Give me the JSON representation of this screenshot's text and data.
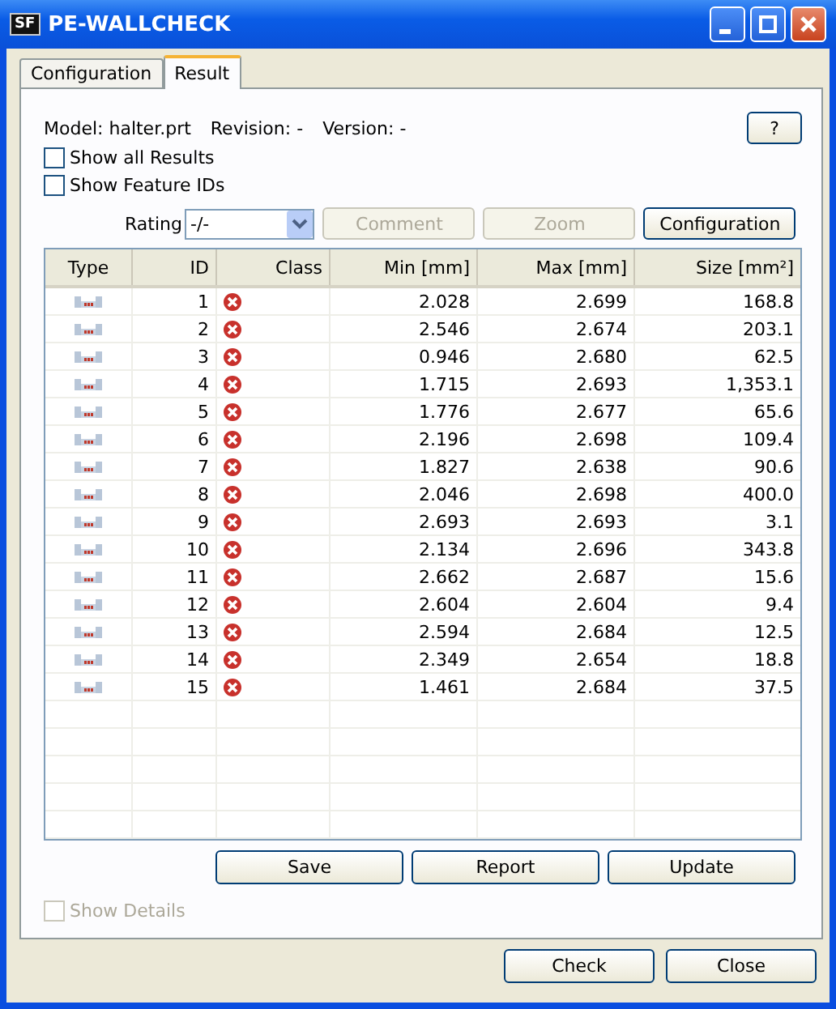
{
  "window": {
    "app_icon": "SF",
    "title": "PE-WALLCHECK"
  },
  "tabs": [
    {
      "label": "Configuration",
      "selected": false
    },
    {
      "label": "Result",
      "selected": true
    }
  ],
  "model_line": {
    "model": "Model:  halter.prt",
    "revision": "Revision:  -",
    "version": "Version:  -"
  },
  "help_button": {
    "label": "?"
  },
  "checkboxes": [
    {
      "label": "Show all Results",
      "checked": false
    },
    {
      "label": "Show Feature IDs",
      "checked": false
    }
  ],
  "rating": {
    "label": "Rating",
    "value": "-/-"
  },
  "toolbar_buttons": [
    {
      "label": "Comment",
      "disabled": true
    },
    {
      "label": "Zoom",
      "disabled": true
    },
    {
      "label": "Configuration",
      "disabled": false
    }
  ],
  "table": {
    "columns": [
      "Type",
      "ID",
      "Class",
      "Min [mm]",
      "Max [mm]",
      "Size [mm²]"
    ],
    "rows": [
      {
        "id": "1",
        "kind": "error",
        "min": "2.028",
        "max": "2.699",
        "size": "168.8"
      },
      {
        "id": "2",
        "kind": "error",
        "min": "2.546",
        "max": "2.674",
        "size": "203.1"
      },
      {
        "id": "3",
        "kind": "error",
        "min": "0.946",
        "max": "2.680",
        "size": "62.5"
      },
      {
        "id": "4",
        "kind": "error",
        "min": "1.715",
        "max": "2.693",
        "size": "1,353.1"
      },
      {
        "id": "5",
        "kind": "error",
        "min": "1.776",
        "max": "2.677",
        "size": "65.6"
      },
      {
        "id": "6",
        "kind": "error",
        "min": "2.196",
        "max": "2.698",
        "size": "109.4"
      },
      {
        "id": "7",
        "kind": "error",
        "min": "1.827",
        "max": "2.638",
        "size": "90.6"
      },
      {
        "id": "8",
        "kind": "error",
        "min": "2.046",
        "max": "2.698",
        "size": "400.0"
      },
      {
        "id": "9",
        "kind": "error",
        "min": "2.693",
        "max": "2.693",
        "size": "3.1"
      },
      {
        "id": "10",
        "kind": "error",
        "min": "2.134",
        "max": "2.696",
        "size": "343.8"
      },
      {
        "id": "11",
        "kind": "error",
        "min": "2.662",
        "max": "2.687",
        "size": "15.6"
      },
      {
        "id": "12",
        "kind": "error",
        "min": "2.604",
        "max": "2.604",
        "size": "9.4"
      },
      {
        "id": "13",
        "kind": "error",
        "min": "2.594",
        "max": "2.684",
        "size": "12.5"
      },
      {
        "id": "14",
        "kind": "error",
        "min": "2.349",
        "max": "2.654",
        "size": "18.8"
      },
      {
        "id": "15",
        "kind": "error",
        "min": "1.461",
        "max": "2.684",
        "size": "37.5"
      }
    ]
  },
  "action_buttons": [
    "Save",
    "Report",
    "Update"
  ],
  "show_details": {
    "label": "Show Details",
    "checked": false,
    "disabled": true
  },
  "footer_buttons": [
    "Check",
    "Close"
  ]
}
